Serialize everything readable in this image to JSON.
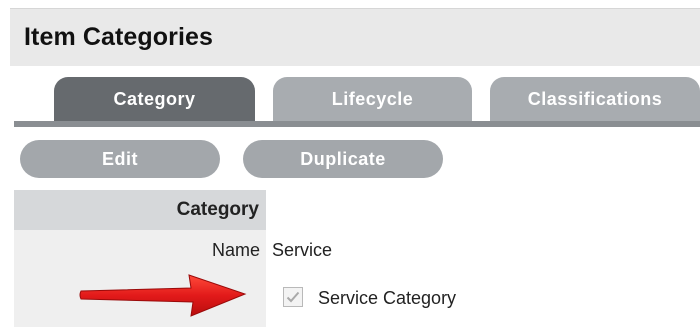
{
  "header": {
    "title": "Item Categories"
  },
  "tabs": [
    {
      "label": "Category",
      "active": true
    },
    {
      "label": "Lifecycle",
      "active": false
    },
    {
      "label": "Classifications",
      "active": false
    }
  ],
  "actions": {
    "edit_label": "Edit",
    "duplicate_label": "Duplicate"
  },
  "section": {
    "header": "Category"
  },
  "fields": {
    "name_label": "Name",
    "name_value": "Service",
    "service_category_label": "Service Category",
    "service_category_checked": true
  },
  "icons": {
    "annotation_arrow": "red-arrow-icon",
    "checkbox": "checkmark-icon"
  },
  "colors": {
    "title_bar": "#e9e9e9",
    "tab_active": "#666a6e",
    "tab_inactive": "#a8acb0",
    "button": "#a3a7ab",
    "section_header": "#d6d8da",
    "label_column": "#efefef",
    "arrow": "#e21a1a"
  }
}
